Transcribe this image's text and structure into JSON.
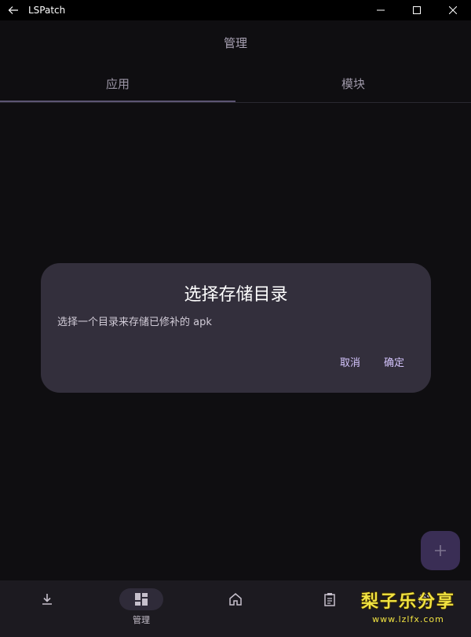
{
  "window": {
    "title": "LSPatch"
  },
  "appbar": {
    "title": "管理"
  },
  "tabs": [
    {
      "label": "应用",
      "active": true
    },
    {
      "label": "模块",
      "active": false
    }
  ],
  "dialog": {
    "title": "选择存储目录",
    "body": "选择一个目录来存储已修补的 apk",
    "cancel_label": "取消",
    "confirm_label": "确定"
  },
  "fab": {
    "icon": "plus-icon"
  },
  "bottomnav": {
    "items": [
      {
        "icon": "download-icon",
        "label": "",
        "active": false
      },
      {
        "icon": "dashboard-icon",
        "label": "管理",
        "active": true
      },
      {
        "icon": "home-icon",
        "label": "",
        "active": false
      },
      {
        "icon": "clipboard-icon",
        "label": "",
        "active": false
      },
      {
        "icon": "settings-icon",
        "label": "",
        "active": false
      }
    ]
  },
  "watermark": {
    "text": "梨子乐分享",
    "url": "www.lzlfx.com"
  },
  "colors": {
    "background": "#0f0e11",
    "dialog": "#332f3c",
    "accent": "#d6c6ff",
    "fab": "#3a2e55"
  }
}
